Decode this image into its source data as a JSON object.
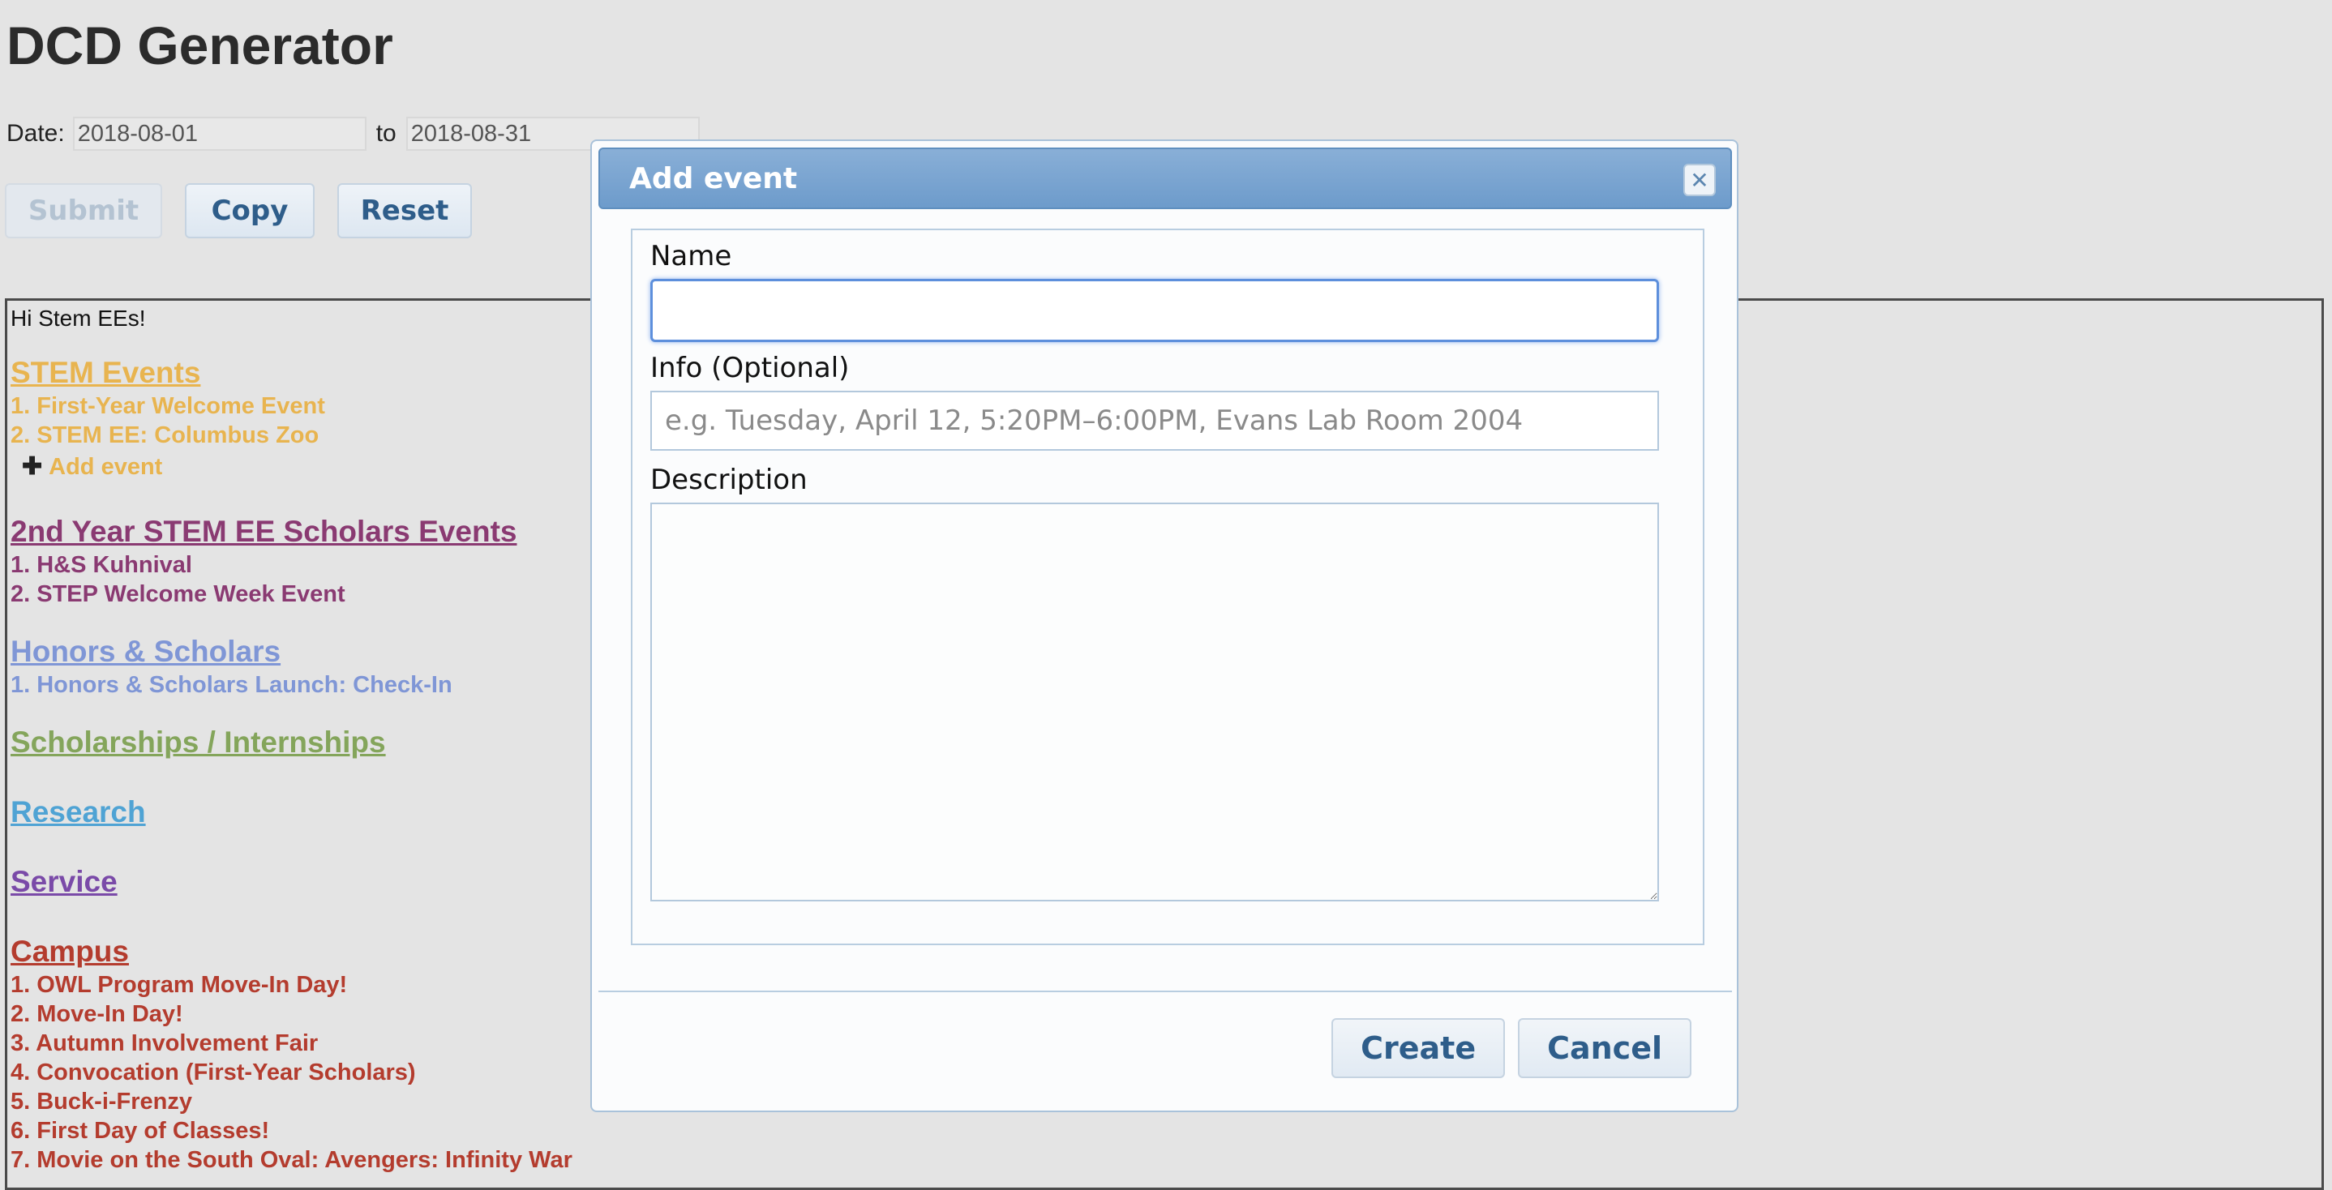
{
  "page": {
    "title": "DCD Generator",
    "date_label": "Date:",
    "date_from": "2018-08-01",
    "date_to_label": "to",
    "date_to": "2018-08-31",
    "buttons": {
      "submit": "Submit",
      "copy": "Copy",
      "reset": "Reset"
    }
  },
  "content": {
    "greeting": "Hi Stem EEs!",
    "sections": [
      {
        "title": "STEM Events",
        "color": "#e8b44f",
        "items": [
          "1. First-Year Welcome Event",
          "2. STEM EE: Columbus Zoo"
        ],
        "add_label": "Add event"
      },
      {
        "title": "2nd Year STEM EE Scholars Events",
        "color": "#8a3a72",
        "items": [
          "1. H&S Kuhnival",
          "2. STEP Welcome Week Event"
        ]
      },
      {
        "title": "Honors & Scholars",
        "color": "#7f96d6",
        "items": [
          "1. Honors & Scholars Launch: Check-In"
        ]
      },
      {
        "title": "Scholarships / Internships",
        "color": "#84a55b",
        "items": []
      },
      {
        "title": "Research",
        "color": "#4fa3d4",
        "items": []
      },
      {
        "title": "Service",
        "color": "#7a4aa8",
        "items": []
      },
      {
        "title": "Campus",
        "color": "#b43c2e",
        "items": [
          "1. OWL Program Move-In Day!",
          "2. Move-In Day!",
          "3. Autumn Involvement Fair",
          "4. Convocation (First-Year Scholars)",
          "5. Buck-i-Frenzy",
          "6. First Day of Classes!",
          "7. Movie on the South Oval: Avengers: Infinity War"
        ]
      }
    ]
  },
  "dialog": {
    "title": "Add event",
    "close_icon": "close-icon",
    "name_label": "Name",
    "name_value": "",
    "info_label": "Info (Optional)",
    "info_placeholder": "e.g. Tuesday, April 12, 5:20PM–6:00PM, Evans Lab Room 2004",
    "description_label": "Description",
    "description_value": "",
    "create_label": "Create",
    "cancel_label": "Cancel"
  }
}
